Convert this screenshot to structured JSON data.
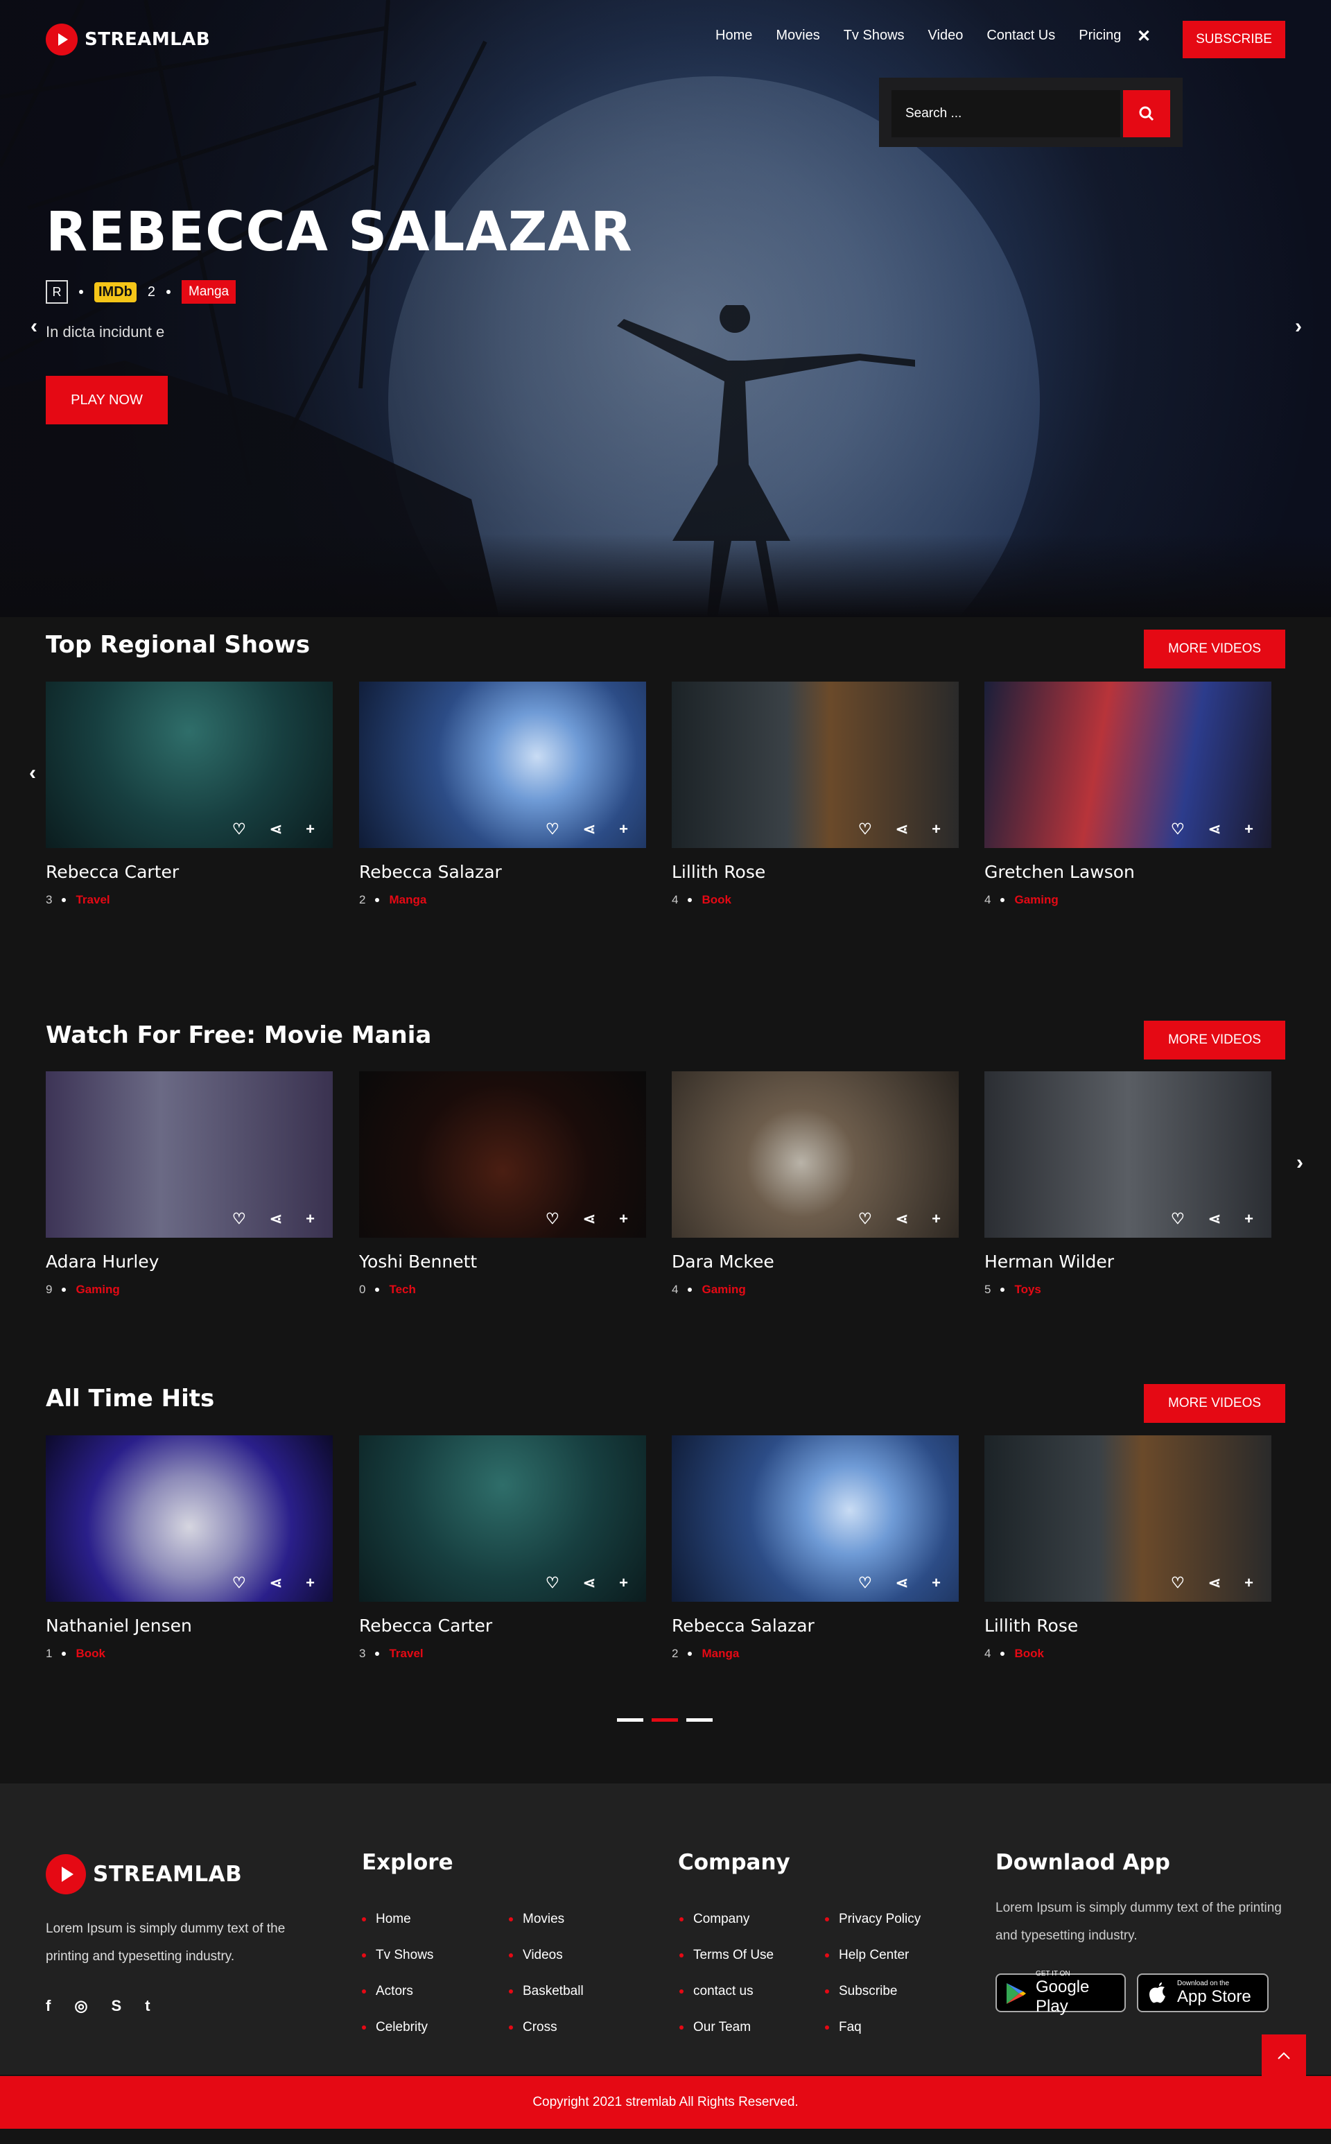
{
  "brand": {
    "name": "STREAMLAB"
  },
  "nav": {
    "items": [
      "Home",
      "Movies",
      "Tv Shows",
      "Video",
      "Contact Us",
      "Pricing"
    ],
    "subscribe": "SUBSCRIBE",
    "close": "✕"
  },
  "search": {
    "placeholder": "Search ..."
  },
  "hero": {
    "title": "REBECCA SALAZAR",
    "rating": "R",
    "imdb_label": "IMDb",
    "imdb_value": "2",
    "genre": "Manga",
    "description": "In dicta incidunt e",
    "play_label": "PLAY NOW"
  },
  "sections": [
    {
      "title": "Top Regional Shows",
      "more_label": "MORE VIDEOS",
      "cards": [
        {
          "title": "Rebecca Carter",
          "count": "3",
          "genre": "Travel"
        },
        {
          "title": "Rebecca Salazar",
          "count": "2",
          "genre": "Manga"
        },
        {
          "title": "Lillith Rose",
          "count": "4",
          "genre": "Book"
        },
        {
          "title": "Gretchen Lawson",
          "count": "4",
          "genre": "Gaming"
        }
      ]
    },
    {
      "title": "Watch For Free: Movie Mania",
      "more_label": "MORE VIDEOS",
      "cards": [
        {
          "title": "Adara Hurley",
          "count": "9",
          "genre": "Gaming"
        },
        {
          "title": "Yoshi Bennett",
          "count": "0",
          "genre": "Tech"
        },
        {
          "title": "Dara Mckee",
          "count": "4",
          "genre": "Gaming"
        },
        {
          "title": "Herman Wilder",
          "count": "5",
          "genre": "Toys"
        }
      ]
    },
    {
      "title": "All Time Hits",
      "more_label": "MORE VIDEOS",
      "cards": [
        {
          "title": "Nathaniel Jensen",
          "count": "1",
          "genre": "Book"
        },
        {
          "title": "Rebecca Carter",
          "count": "3",
          "genre": "Travel"
        },
        {
          "title": "Rebecca Salazar",
          "count": "2",
          "genre": "Manga"
        },
        {
          "title": "Lillith Rose",
          "count": "4",
          "genre": "Book"
        }
      ]
    }
  ],
  "footer": {
    "brand": "STREAMLAB",
    "description": "Lorem Ipsum is simply dummy text of the printing and typesetting industry.",
    "social": [
      "facebook-icon",
      "instagram-icon",
      "skype-icon",
      "twitter-icon"
    ],
    "explore": {
      "title": "Explore",
      "col1": [
        "Home",
        "Tv Shows",
        "Actors",
        "Celebrity"
      ],
      "col2": [
        "Movies",
        "Videos",
        "Basketball",
        "Cross"
      ]
    },
    "company": {
      "title": "Company",
      "col1": [
        "Company",
        "Terms Of Use",
        "contact us",
        "Our Team"
      ],
      "col2": [
        "Privacy Policy",
        "Help Center",
        "Subscribe",
        "Faq"
      ]
    },
    "app": {
      "title": "Downlaod App",
      "description": "Lorem Ipsum is simply dummy text of the printing and typesetting industry.",
      "google_small": "GET IT ON",
      "google_big": "Google Play",
      "apple_small": "Download on the",
      "apple_big": "App Store"
    },
    "copyright": "Copyright 2021 stremlab All Rights Reserved."
  },
  "colors": {
    "accent": "#e50914",
    "background": "#141414",
    "footer": "#212121"
  }
}
